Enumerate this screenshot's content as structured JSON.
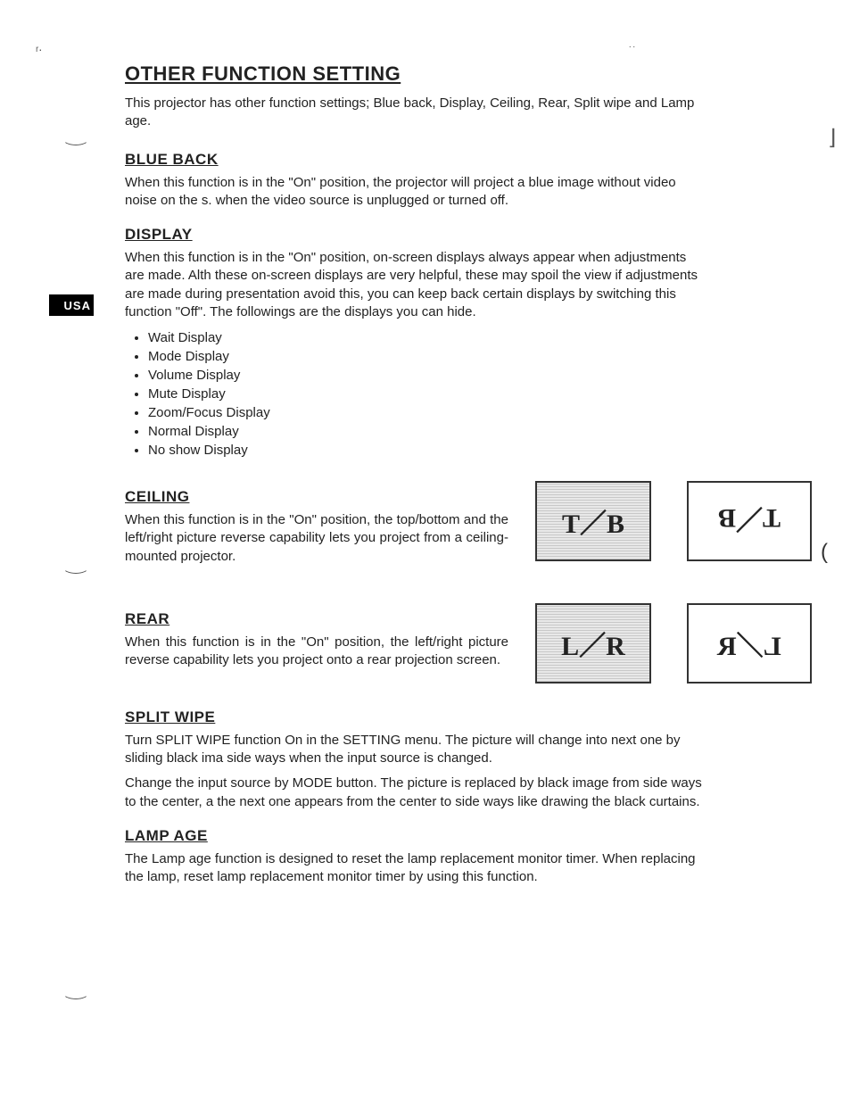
{
  "badge": "USA",
  "title": "OTHER FUNCTION SETTING",
  "intro": "This projector has other function settings; Blue back, Display, Ceiling, Rear, Split wipe and Lamp age.",
  "blueback": {
    "heading": "BLUE BACK",
    "text": "When this function is in the \"On\" position, the projector will project a blue image without video noise on the s. when the video source is unplugged or turned off."
  },
  "display": {
    "heading": "DISPLAY",
    "text": "When this function is in the \"On\" position, on-screen displays always appear when adjustments are made. Alth these on-screen displays are very helpful, these may spoil the view if adjustments are made during presentation avoid this, you can keep back certain displays by switching this function \"Off\". The followings are the displays you can hide.",
    "items": [
      "Wait Display",
      "Mode Display",
      "Volume Display",
      "Mute Display",
      "Zoom/Focus Display",
      "Normal Display",
      "No show Display"
    ]
  },
  "ceiling": {
    "heading": "CEILING",
    "text": "When this function is in the \"On\" position, the top/bottom and the left/right picture reverse capability lets you project from a ceiling-mounted projector.",
    "diag_left": "T／B",
    "diag_right": "T／B"
  },
  "rear": {
    "heading": "REAR",
    "text": "When this function is in the \"On\" position, the left/right picture reverse capability lets you project onto a rear projection screen.",
    "diag_left": "L／R",
    "diag_right": "L／R"
  },
  "splitwipe": {
    "heading": "SPLIT WIPE",
    "text1": "Turn SPLIT WIPE function On in the SETTING menu. The picture will change into next one by sliding black ima side ways when the input source is changed.",
    "text2": "Change the input source by MODE button. The picture is replaced by black image from side ways to the center, a the next one appears from the center to side ways like drawing the black curtains."
  },
  "lampage": {
    "heading": "LAMP AGE",
    "text": "The Lamp age function is designed to reset the lamp replacement monitor timer. When replacing the lamp, reset lamp replacement monitor timer by using this function."
  }
}
